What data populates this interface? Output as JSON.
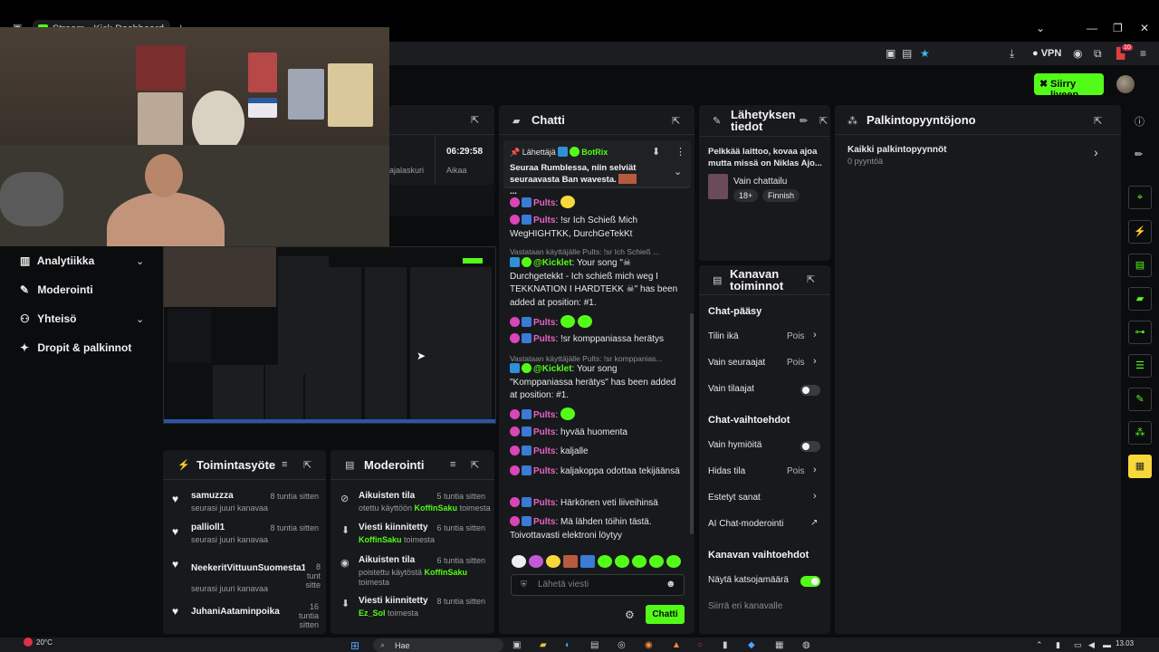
{
  "browser": {
    "tab_title": "Stream - Kick Dashboard",
    "vpn_label": "VPN",
    "ext_badge": "10"
  },
  "header": {
    "go_live_label": "Siirry liveen"
  },
  "sidebar": {
    "items": [
      {
        "label": "Analytiikka",
        "has_chevron": true
      },
      {
        "label": "Moderointi",
        "has_chevron": false
      },
      {
        "label": "Yhteisö",
        "has_chevron": true
      },
      {
        "label": "Dropit & palkinnot",
        "has_chevron": false
      }
    ]
  },
  "stream_stats": {
    "time_value": "06:29:58",
    "time_label": "Aikaa",
    "counter_label": "ajalaskuri"
  },
  "activity_feed": {
    "title": "Toimintasyöte",
    "items": [
      {
        "name": "samuzzza",
        "sub": "seurasi juuri kanavaa",
        "time": "8 tuntia sitten"
      },
      {
        "name": "pallioll1",
        "sub": "seurasi juuri kanavaa",
        "time": "8 tuntia sitten"
      },
      {
        "name": "NeekeritVittuunSuomesta17",
        "sub": "seurasi juuri kanavaa",
        "time": "8 tunt sitte"
      },
      {
        "name": "JuhaniAataminpoika",
        "sub": "seurasi juuri kanavaa",
        "time": "16 tuntia sitten"
      }
    ]
  },
  "moderation_feed": {
    "title": "Moderointi",
    "items": [
      {
        "name": "Aikuisten tila",
        "pre": "otettu käyttöön ",
        "actor": "KoffinSaku",
        "post": " toimesta",
        "time": "5 tuntia sitten"
      },
      {
        "name": "Viesti kiinnitetty",
        "pre": "",
        "actor": "KoffinSaku",
        "post": " toimesta",
        "time": "6 tuntia sitten"
      },
      {
        "name": "Aikuisten tila",
        "pre": "poistettu käytöstä ",
        "actor": "KoffinSaku",
        "post": " toimesta",
        "time": "6 tuntia sitten"
      },
      {
        "name": "Viesti kiinnitetty",
        "pre": "",
        "actor": "Ez_Sol",
        "post": " toimesta",
        "time": "8 tuntia sitten"
      }
    ]
  },
  "chat": {
    "title": "Chatti",
    "pinned": {
      "label": "Lähettäjä",
      "author": "BotRix",
      "text": "Seuraa Rumblessa, niin selviät seuraavasta Ban wavesta.",
      "ellipsis": "..."
    },
    "messages": [
      {
        "user": "Pults",
        "text": "",
        "kind": "emote-y"
      },
      {
        "user": "Pults",
        "text": "!sr Ich Schieß Mich WegHIGHTKK, DurchGeTekKt",
        "kind": "text"
      },
      {
        "reply": "Vastataan käyttäjälle Pults: !sr Ich Schieß ..."
      },
      {
        "user": "@Kicklet",
        "text": "Your song \"☠ Durchgetekkt - Ich schieß mich weg I TEKKNATION I HARDTEKK ☠\" has been added at position: #1.",
        "kind": "bot"
      },
      {
        "user": "Pults",
        "text": "",
        "kind": "emote2"
      },
      {
        "user": "Pults",
        "text": "!sr komppaniassa herätys",
        "kind": "text"
      },
      {
        "reply": "Vastataan käyttäjälle Pults: !sr komppanias..."
      },
      {
        "user": "@Kicklet",
        "text": "Your song \"Komppaniassa herätys\" has been added at position: #1.",
        "kind": "bot"
      },
      {
        "user": "Pults",
        "text": "",
        "kind": "emote1"
      },
      {
        "user": "Pults",
        "text": "hyvää huomenta",
        "kind": "text"
      },
      {
        "user": "Pults",
        "text": "kaljalle",
        "kind": "text"
      },
      {
        "user": "Pults",
        "text": "kaljakoppa odottaa tekijäänsä",
        "kind": "text"
      },
      {
        "user": "Pults",
        "text": "Härkönen veti liiveihinsä",
        "kind": "text"
      },
      {
        "user": "Pults",
        "text": "Mä lähden töihin tästä. Toivottavasti elektroni löytyy",
        "kind": "text"
      }
    ],
    "input_placeholder": "Lähetä viesti",
    "send_label": "Chatti"
  },
  "stream_info": {
    "title": "Lähetyksen tiedot",
    "stream_title": "Pelkkää laittoo, kovaa ajoa mutta missä on Niklas Ajo...",
    "category": "Vain chattailu",
    "tags": [
      "18+",
      "Finnish"
    ]
  },
  "channel_actions": {
    "title": "Kanavan toiminnot",
    "chat_access_title": "Chat-pääsy",
    "rows1": [
      {
        "label": "Tilin ikä",
        "value": "Pois",
        "control": "chevron"
      },
      {
        "label": "Vain seuraajat",
        "value": "Pois",
        "control": "chevron"
      },
      {
        "label": "Vain tilaajat",
        "value": "",
        "control": "toggle-off"
      }
    ],
    "chat_options_title": "Chat-vaihtoehdot",
    "rows2": [
      {
        "label": "Vain hymiöitä",
        "value": "",
        "control": "toggle-off"
      },
      {
        "label": "Hidas tila",
        "value": "Pois",
        "control": "chevron"
      },
      {
        "label": "Estetyt sanat",
        "value": "",
        "control": "chevron"
      },
      {
        "label": "AI Chat-moderointi",
        "value": "",
        "control": "ext"
      }
    ],
    "channel_options_title": "Kanavan vaihtoehdot",
    "rows3": [
      {
        "label": "Näytä katsojamäärä",
        "value": "",
        "control": "toggle-on"
      },
      {
        "label": "Siirrä eri kanavalle",
        "value": "",
        "control": "none"
      }
    ]
  },
  "rewards": {
    "title": "Palkintopyyntöjono",
    "all_label": "Kaikki palkintopyynnöt",
    "count_label": "0 pyyntöä"
  },
  "taskbar": {
    "temp": "20°C",
    "search_label": "Hae",
    "clock": "13.03"
  },
  "colors": {
    "accent": "#53fc18",
    "panel": "#18191c",
    "background": "#0b0c0e",
    "username_pink": "#e763c3"
  }
}
